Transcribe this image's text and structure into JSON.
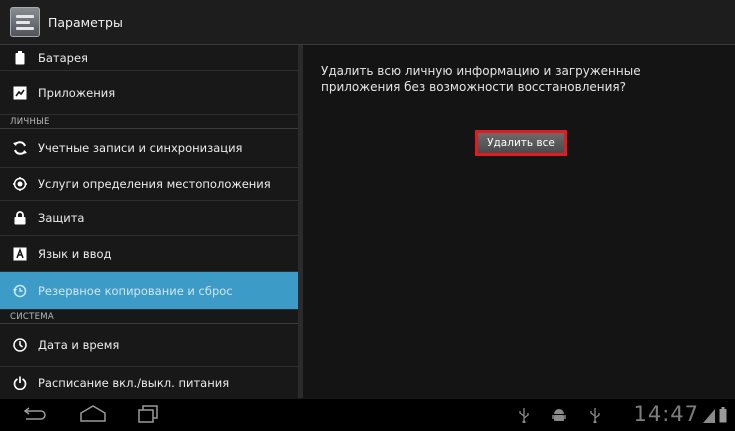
{
  "app": {
    "title": "Параметры"
  },
  "sidebar": {
    "items_top": [
      {
        "label": "Батарея",
        "icon": "battery-icon"
      },
      {
        "label": "Приложения",
        "icon": "apps-icon"
      }
    ],
    "section_personal": "ЛИЧНЫЕ",
    "items_personal": [
      {
        "label": "Учетные записи и синхронизация",
        "icon": "sync-icon"
      },
      {
        "label": "Услуги определения местоположения",
        "icon": "location-icon"
      },
      {
        "label": "Защита",
        "icon": "lock-icon"
      },
      {
        "label": "Язык и ввод",
        "icon": "language-icon"
      },
      {
        "label": "Резервное копирование и сброс",
        "icon": "backup-icon",
        "selected": true
      }
    ],
    "section_system": "СИСТЕМА",
    "items_system": [
      {
        "label": "Дата и время",
        "icon": "clock-icon"
      },
      {
        "label": "Расписание вкл./выкл. питания",
        "icon": "power-icon"
      }
    ]
  },
  "detail": {
    "message": "Удалить всю личную информацию и загруженные приложения без возможности восстановления?",
    "erase_button": "Удалить все"
  },
  "statusbar": {
    "time": "14:47",
    "colors": {
      "accent": "#3d9bc7",
      "highlight": "#e11b22"
    }
  }
}
